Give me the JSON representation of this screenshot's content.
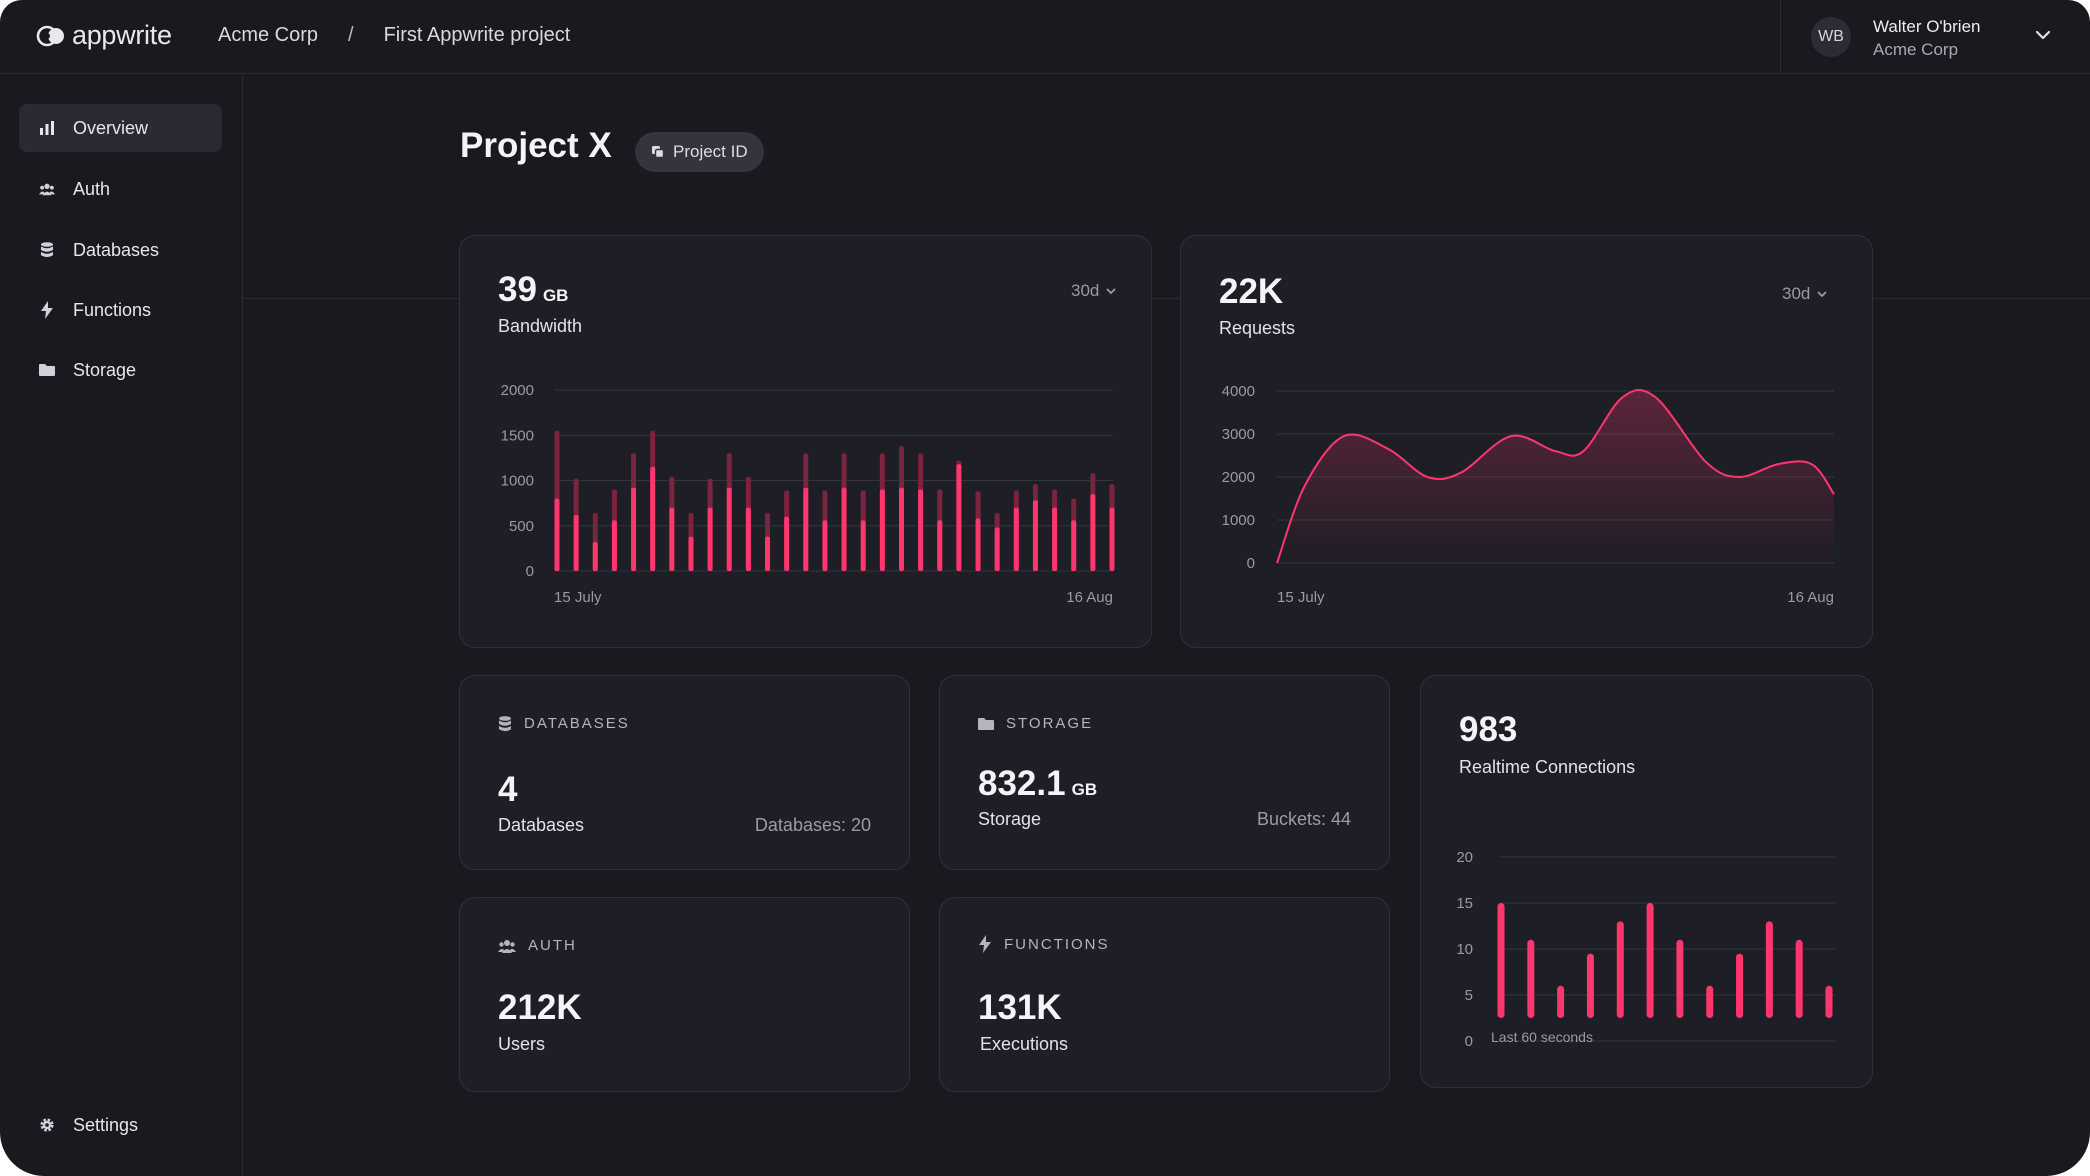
{
  "brand": {
    "name": "appwrite"
  },
  "breadcrumb": {
    "org": "Acme Corp",
    "separator": "/",
    "project": "First Appwrite project"
  },
  "user": {
    "initials": "WB",
    "name": "Walter O'brien",
    "org": "Acme Corp"
  },
  "sidebar": {
    "items": [
      {
        "label": "Overview",
        "icon": "bar-chart-icon"
      },
      {
        "label": "Auth",
        "icon": "users-icon"
      },
      {
        "label": "Databases",
        "icon": "database-icon"
      },
      {
        "label": "Functions",
        "icon": "lightning-icon"
      },
      {
        "label": "Storage",
        "icon": "folder-icon"
      }
    ],
    "settings": {
      "label": "Settings",
      "icon": "gear-icon"
    }
  },
  "page": {
    "title": "Project X",
    "project_id_label": "Project ID"
  },
  "bandwidth": {
    "value": "39",
    "unit": "GB",
    "label": "Bandwidth",
    "range": "30d"
  },
  "requests": {
    "value": "22K",
    "label": "Requests",
    "range": "30d"
  },
  "databases": {
    "section": "DATABASES",
    "value": "4",
    "label": "Databases",
    "meta": "Databases: 20"
  },
  "storage": {
    "section": "STORAGE",
    "value": "832.1",
    "unit": "GB",
    "label": "Storage",
    "meta": "Buckets: 44"
  },
  "auth": {
    "section": "AUTH",
    "value": "212K",
    "label": "Users"
  },
  "functions": {
    "section": "FUNCTIONS",
    "value": "131K",
    "label": "Executions"
  },
  "realtime": {
    "value": "983",
    "label": "Realtime Connections",
    "caption": "Last 60 seconds"
  },
  "colors": {
    "accent": "#fd366e",
    "accent_dim": "#7a2440",
    "background": "#19191f",
    "card": "#1e1e26"
  },
  "chart_data": [
    {
      "type": "bar",
      "title": "Bandwidth",
      "x_start_label": "15 July",
      "x_end_label": "16 Aug",
      "yticks": [
        0,
        500,
        1000,
        1500,
        2000
      ],
      "ylim": [
        0,
        2000
      ],
      "grid": true,
      "series": [
        {
          "values": [
            800,
            620,
            320,
            560,
            920,
            1150,
            700,
            380,
            700,
            920,
            700,
            380,
            600,
            920,
            560,
            920,
            560,
            900,
            920,
            900,
            560,
            1180,
            580,
            480,
            700,
            780,
            700,
            560,
            850,
            700
          ]
        },
        {
          "values": [
            1550,
            1020,
            640,
            900,
            1300,
            1550,
            1040,
            640,
            1020,
            1300,
            1040,
            640,
            890,
            1300,
            890,
            1300,
            890,
            1300,
            1380,
            1300,
            900,
            1220,
            880,
            640,
            890,
            960,
            900,
            800,
            1080,
            960
          ]
        }
      ]
    },
    {
      "type": "area",
      "title": "Requests",
      "x_start_label": "15 July",
      "x_end_label": "16 Aug",
      "yticks": [
        0,
        1000,
        2000,
        3000,
        4000
      ],
      "ylim": [
        0,
        4000
      ],
      "grid": true,
      "series": [
        {
          "x": [
            0,
            0.05,
            0.12,
            0.2,
            0.27,
            0.33,
            0.42,
            0.5,
            0.55,
            0.62,
            0.68,
            0.77,
            0.83,
            0.9,
            0.96,
            1.0
          ],
          "values": [
            0,
            1800,
            2950,
            2650,
            2000,
            2100,
            2950,
            2600,
            2600,
            3850,
            3850,
            2350,
            2000,
            2300,
            2300,
            1600
          ]
        }
      ]
    },
    {
      "type": "bar",
      "title": "Realtime Connections",
      "caption": "Last 60 seconds",
      "yticks": [
        0,
        5,
        10,
        15,
        20
      ],
      "ylim": [
        0,
        20
      ],
      "grid": true,
      "series": [
        {
          "values": [
            15,
            11,
            6,
            9.5,
            13,
            15,
            11,
            6,
            9.5,
            13,
            11,
            6
          ]
        }
      ]
    }
  ]
}
